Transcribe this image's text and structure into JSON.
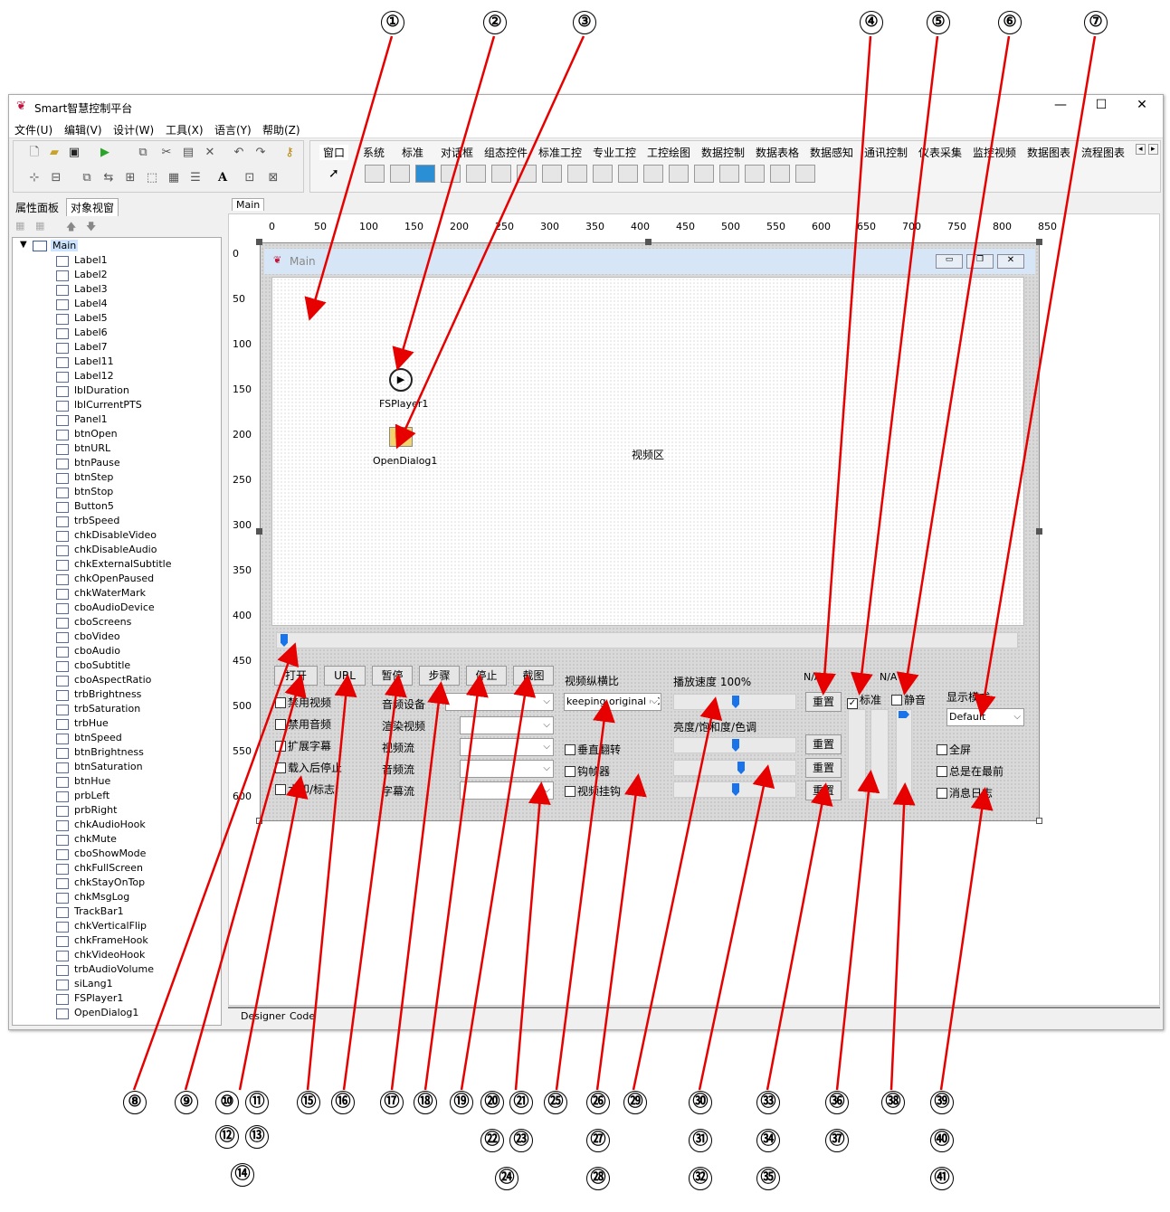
{
  "window": {
    "title": "Smart智慧控制平台",
    "min": "—",
    "max": "☐",
    "close": "✕"
  },
  "menu": [
    "文件(U)",
    "编辑(V)",
    "设计(W)",
    "工具(X)",
    "语言(Y)",
    "帮助(Z)"
  ],
  "palette_tabs": [
    "窗口",
    "系统",
    "标准",
    "对话框",
    "组态控件",
    "标准工控",
    "专业工控",
    "工控绘图",
    "数据控制",
    "数据表格",
    "数据感知",
    "通讯控制",
    "仪表采集",
    "监控视频",
    "数据图表",
    "流程图表"
  ],
  "left_tabs": [
    "属性面板",
    "对象视窗"
  ],
  "design_tab": "Main",
  "bottom_tabs": [
    "Designer",
    "Code"
  ],
  "tree": {
    "root": "Main",
    "items": [
      "Label1",
      "Label2",
      "Label3",
      "Label4",
      "Label5",
      "Label6",
      "Label7",
      "Label11",
      "Label12",
      "lblDuration",
      "lblCurrentPTS",
      "Panel1",
      "btnOpen",
      "btnURL",
      "btnPause",
      "btnStep",
      "btnStop",
      "Button5",
      "trbSpeed",
      "chkDisableVideo",
      "chkDisableAudio",
      "chkExternalSubtitle",
      "chkOpenPaused",
      "chkWaterMark",
      "cboAudioDevice",
      "cboScreens",
      "cboVideo",
      "cboAudio",
      "cboSubtitle",
      "cboAspectRatio",
      "trbBrightness",
      "trbSaturation",
      "trbHue",
      "btnSpeed",
      "btnBrightness",
      "btnSaturation",
      "btnHue",
      "prbLeft",
      "prbRight",
      "chkAudioHook",
      "chkMute",
      "cboShowMode",
      "chkFullScreen",
      "chkStayOnTop",
      "chkMsgLog",
      "TrackBar1",
      "chkVerticalFlip",
      "chkFrameHook",
      "chkVideoHook",
      "trbAudioVolume",
      "siLang1",
      "FSPlayer1",
      "OpenDialog1"
    ]
  },
  "ruler_h": [
    "0",
    "50",
    "100",
    "150",
    "200",
    "250",
    "300",
    "350",
    "400",
    "450",
    "500",
    "550",
    "600",
    "650",
    "700",
    "750",
    "800",
    "850"
  ],
  "ruler_v": [
    "0",
    "50",
    "100",
    "150",
    "200",
    "250",
    "300",
    "350",
    "400",
    "450",
    "500",
    "550",
    "600"
  ],
  "form": {
    "title": "Main",
    "fsplayer": "FSPlayer1",
    "opendialog": "OpenDialog1",
    "video_label": "视频区",
    "buttons": [
      "打开",
      "URL",
      "暂停",
      "步骤",
      "停止",
      "截图"
    ],
    "checks_left": [
      "禁用视频",
      "禁用音频",
      "扩展字幕",
      "载入后停止",
      "水印/标志"
    ],
    "labels_mid": [
      "音频设备",
      "渲染视频",
      "视频流",
      "音频流",
      "字幕流"
    ],
    "aspect_label": "视频纵横比",
    "aspect_value": "keeping original (C",
    "checks_mid": [
      "垂直翻转",
      "钩帧器",
      "视频挂钩"
    ],
    "speed_label": "播放速度 100%",
    "bsh_label": "亮度/饱和度/色调",
    "na1": "N/A",
    "na2": "N/A",
    "reset": "重置",
    "chk_standard": "标准",
    "chk_mute": "静音",
    "show_mode_label": "显示模式",
    "show_mode_value": "Default",
    "checks_right": [
      "全屏",
      "总是在最前",
      "消息日志"
    ]
  },
  "callouts": [
    "①",
    "②",
    "③",
    "④",
    "⑤",
    "⑥",
    "⑦",
    "⑧",
    "⑨",
    "⑩",
    "⑪",
    "⑫",
    "⑬",
    "⑭",
    "⑮",
    "⑯",
    "⑰",
    "⑱",
    "⑲",
    "⑳",
    "㉑",
    "㉒",
    "㉓",
    "㉔",
    "㉕",
    "㉖",
    "㉗",
    "㉘",
    "㉙",
    "㉚",
    "㉛",
    "㉜",
    "㉝",
    "㉞",
    "㉟",
    "㊱",
    "㊲",
    "㊳",
    "㊴",
    "㊵",
    "㊶"
  ]
}
